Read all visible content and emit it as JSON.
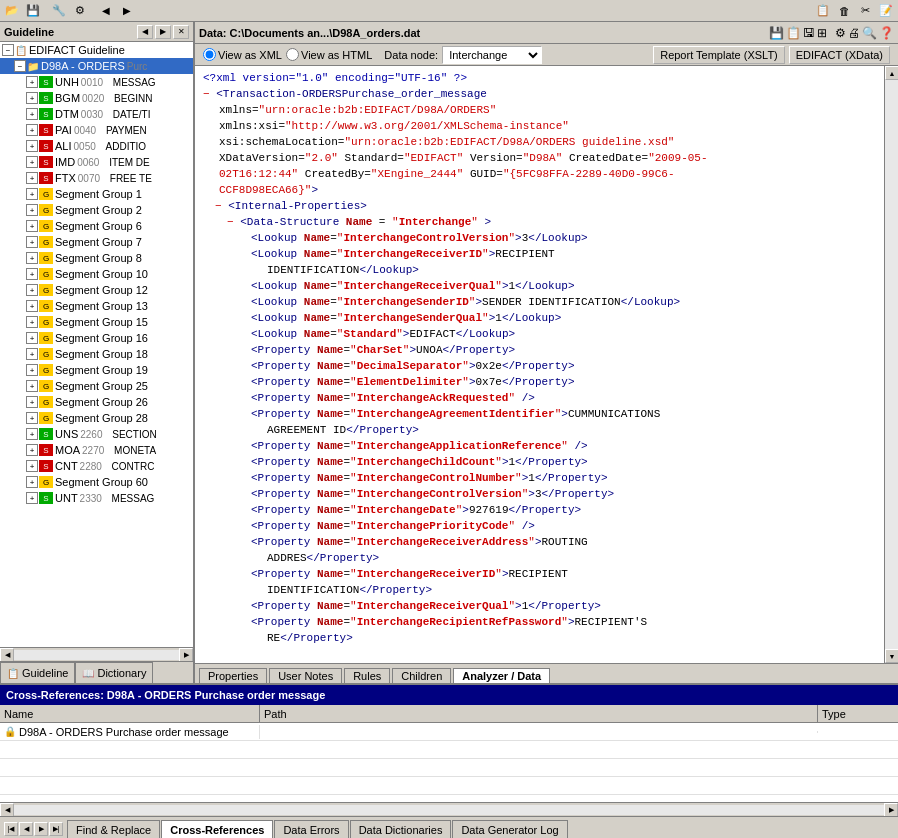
{
  "left_panel": {
    "title": "Guideline",
    "tree_items": [
      {
        "id": "edifact",
        "label": "EDIFACT Guideline",
        "indent": 0,
        "type": "root",
        "expanded": true
      },
      {
        "id": "d98a",
        "label": "D98A - ORDERS",
        "indent": 1,
        "type": "folder",
        "expanded": true,
        "suffix": "Purc"
      },
      {
        "id": "unh",
        "label": "UNH",
        "num": "0010",
        "desc": "MESSAG",
        "indent": 2,
        "type": "green",
        "expanded": false
      },
      {
        "id": "bgm",
        "label": "BGM",
        "num": "0020",
        "desc": "BEGINN",
        "indent": 2,
        "type": "green",
        "expanded": false
      },
      {
        "id": "dtm",
        "label": "DTM",
        "num": "0030",
        "desc": "DATE/TI",
        "indent": 2,
        "type": "green",
        "expanded": false
      },
      {
        "id": "pai",
        "label": "PAI",
        "num": "0040",
        "desc": "PAYMEN",
        "indent": 2,
        "type": "red",
        "expanded": false
      },
      {
        "id": "ali",
        "label": "ALI",
        "num": "0050",
        "desc": "ADDITIO",
        "indent": 2,
        "type": "red",
        "expanded": false
      },
      {
        "id": "imd",
        "label": "IMD",
        "num": "0060",
        "desc": "ITEM DE",
        "indent": 2,
        "type": "red",
        "expanded": false
      },
      {
        "id": "ftx",
        "label": "FTX",
        "num": "0070",
        "desc": "FREE TE",
        "indent": 2,
        "type": "red",
        "expanded": false
      },
      {
        "id": "sg1",
        "label": "Segment Group 1",
        "indent": 2,
        "type": "folder_grp",
        "expanded": false
      },
      {
        "id": "sg2",
        "label": "Segment Group 2",
        "indent": 2,
        "type": "folder_grp",
        "expanded": false
      },
      {
        "id": "sg6",
        "label": "Segment Group 6",
        "indent": 2,
        "type": "folder_grp",
        "expanded": false
      },
      {
        "id": "sg7",
        "label": "Segment Group 7",
        "indent": 2,
        "type": "folder_grp",
        "expanded": false
      },
      {
        "id": "sg8",
        "label": "Segment Group 8",
        "indent": 2,
        "type": "folder_grp",
        "expanded": false
      },
      {
        "id": "sg10",
        "label": "Segment Group 10",
        "indent": 2,
        "type": "folder_grp",
        "expanded": false
      },
      {
        "id": "sg12",
        "label": "Segment Group 12",
        "indent": 2,
        "type": "folder_grp",
        "expanded": false
      },
      {
        "id": "sg13",
        "label": "Segment Group 13",
        "indent": 2,
        "type": "folder_grp",
        "expanded": false
      },
      {
        "id": "sg15",
        "label": "Segment Group 15",
        "indent": 2,
        "type": "folder_grp",
        "expanded": false
      },
      {
        "id": "sg16",
        "label": "Segment Group 16",
        "indent": 2,
        "type": "folder_grp",
        "expanded": false
      },
      {
        "id": "sg18",
        "label": "Segment Group 18",
        "indent": 2,
        "type": "folder_grp",
        "expanded": false
      },
      {
        "id": "sg19",
        "label": "Segment Group 19",
        "indent": 2,
        "type": "folder_grp",
        "expanded": false
      },
      {
        "id": "sg25",
        "label": "Segment Group 25",
        "indent": 2,
        "type": "folder_grp",
        "expanded": false
      },
      {
        "id": "sg26",
        "label": "Segment Group 26",
        "indent": 2,
        "type": "folder_grp",
        "expanded": false
      },
      {
        "id": "sg28",
        "label": "Segment Group 28",
        "indent": 2,
        "type": "folder_grp",
        "expanded": false
      },
      {
        "id": "uns",
        "label": "UNS",
        "num": "2260",
        "desc": "SECTION",
        "indent": 2,
        "type": "green",
        "expanded": false
      },
      {
        "id": "moa",
        "label": "MOA",
        "num": "2270",
        "desc": "MONETA",
        "indent": 2,
        "type": "red",
        "expanded": false
      },
      {
        "id": "cnt",
        "label": "CNT",
        "num": "2280",
        "desc": "CONTRC",
        "indent": 2,
        "type": "red",
        "expanded": false
      },
      {
        "id": "sg60",
        "label": "Segment Group 60",
        "indent": 2,
        "type": "folder_grp",
        "expanded": false
      },
      {
        "id": "unt",
        "label": "UNT",
        "num": "2330",
        "desc": "MESSAG",
        "indent": 2,
        "type": "green",
        "expanded": false
      }
    ],
    "tabs": [
      {
        "id": "guideline",
        "label": "Guideline",
        "active": true,
        "icon": "G"
      },
      {
        "id": "dictionary",
        "label": "Dictionary",
        "active": false,
        "icon": "D"
      }
    ]
  },
  "right_panel": {
    "data_title": "Data: C:\\Documents an...\\D98A_orders.dat",
    "view_xml_label": "View as XML",
    "view_html_label": "View as HTML",
    "data_node_label": "Data node:",
    "data_node_value": "Interchange",
    "report_template_label": "Report Template (XSLT)",
    "edifact_xdata_label": "EDIFACT (XData)",
    "xml_lines": [
      {
        "type": "pi",
        "text": "<?xml version=\"1.0\" encoding=\"UTF-16\" ?>"
      },
      {
        "type": "minus_tag",
        "text": "<Transaction-ORDERSPurchase_order_message"
      },
      {
        "type": "attr_line",
        "text": "  xmlns=\"urn:oracle:b2b:EDIFACT/D98A/ORDERS\""
      },
      {
        "type": "attr_line",
        "text": "  xmlns:xsi=\"http://www.w3.org/2001/XMLSchema-instance\""
      },
      {
        "type": "attr_line",
        "text": "  xsi:schemaLocation=\"urn:oracle:b2b:EDIFACT/D98A/ORDERS guideline.xsd\""
      },
      {
        "type": "attr_line",
        "text": "  XDataVersion=\"2.0\" Standard=\"EDIFACT\" Version=\"D98A\" CreatedDate=\"2009-05-"
      },
      {
        "type": "attr_line",
        "text": "  02T16:12:44\" CreatedBy=\"XEngine_2444\" GUID=\"{5FC98FFA-2289-40D0-99C6-"
      },
      {
        "type": "attr_line",
        "text": "  CCF8D98ECA66}\">"
      },
      {
        "type": "minus_tag",
        "text": "  <Internal-Properties>"
      },
      {
        "type": "minus_tag",
        "text": "    <Data-Structure Name=\"Interchange\">"
      },
      {
        "type": "lookup",
        "text": "      <Lookup Name=\"InterchangeControlVersion\">3</Lookup>"
      },
      {
        "type": "lookup",
        "text": "      <Lookup Name=\"InterchangeReceiverID\">RECIPIENT"
      },
      {
        "type": "lookup",
        "text": "        IDENTIFICATION</Lookup>"
      },
      {
        "type": "lookup",
        "text": "      <Lookup Name=\"InterchangeReceiverQual\">1</Lookup>"
      },
      {
        "type": "lookup",
        "text": "      <Lookup Name=\"InterchangeSenderID\">SENDER IDENTIFICATION</Lookup>"
      },
      {
        "type": "lookup",
        "text": "      <Lookup Name=\"InterchangeSenderQual\">1</Lookup>"
      },
      {
        "type": "lookup",
        "text": "      <Lookup Name=\"Standard\">EDIFACT</Lookup>"
      },
      {
        "type": "property",
        "text": "      <Property Name=\"CharSet\">UNOA</Property>"
      },
      {
        "type": "property",
        "text": "      <Property Name=\"DecimalSeparator\">0x2e</Property>"
      },
      {
        "type": "property",
        "text": "      <Property Name=\"ElementDelimiter\">0x7e</Property>"
      },
      {
        "type": "property",
        "text": "      <Property Name=\"InterchangeAckRequested\" />"
      },
      {
        "type": "property",
        "text": "      <Property Name=\"InterchangeAgreementIdentifier\">CUMMUNICATIONS"
      },
      {
        "type": "property",
        "text": "        AGREEMENT ID</Property>"
      },
      {
        "type": "property",
        "text": "      <Property Name=\"InterchangeApplicationReference\" />"
      },
      {
        "type": "property",
        "text": "      <Property Name=\"InterchangeChildCount\">1</Property>"
      },
      {
        "type": "property",
        "text": "      <Property Name=\"InterchangeControlNumber\">1</Property>"
      },
      {
        "type": "property",
        "text": "      <Property Name=\"InterchangeControlVersion\">3</Property>"
      },
      {
        "type": "property",
        "text": "      <Property Name=\"InterchangeDate\">927619</Property>"
      },
      {
        "type": "property",
        "text": "      <Property Name=\"InterchangePriorityCode\" />"
      },
      {
        "type": "property",
        "text": "      <Property Name=\"InterchangeReceiverAddress\">ROUTING"
      },
      {
        "type": "property",
        "text": "        ADDRES</Property>"
      },
      {
        "type": "property",
        "text": "      <Property Name=\"InterchangeReceiverID\">RECIPIENT"
      },
      {
        "type": "property",
        "text": "        IDENTIFICATION</Property>"
      },
      {
        "type": "property",
        "text": "      <Property Name=\"InterchangeReceiverQual\">1</Property>"
      },
      {
        "type": "property",
        "text": "      <Property Name=\"InterchangeRecipientRefPassword\">RECIPIENT'S"
      },
      {
        "type": "property",
        "text": "        RE</Property>"
      }
    ],
    "bottom_tabs": [
      {
        "id": "properties",
        "label": "Properties",
        "active": false
      },
      {
        "id": "user_notes",
        "label": "User Notes",
        "active": false
      },
      {
        "id": "rules",
        "label": "Rules",
        "active": false
      },
      {
        "id": "children",
        "label": "Children",
        "active": false
      },
      {
        "id": "analyzer_data",
        "label": "Analyzer / Data",
        "active": true
      }
    ]
  },
  "cross_ref": {
    "title": "Cross-References: D98A - ORDERS Purchase order message",
    "columns": [
      "Name",
      "Path",
      "Type"
    ],
    "rows": [
      {
        "icon": "lock",
        "name": "D98A - ORDERS Purchase order message",
        "path": "",
        "type": ""
      }
    ]
  },
  "bottom_tabs": [
    {
      "id": "find_replace",
      "label": "Find & Replace",
      "active": false
    },
    {
      "id": "cross_references",
      "label": "Cross-References",
      "active": true
    },
    {
      "id": "data_errors",
      "label": "Data Errors",
      "active": false
    },
    {
      "id": "data_dictionaries",
      "label": "Data Dictionaries",
      "active": false
    },
    {
      "id": "data_generator_log",
      "label": "Data Generator Log",
      "active": false
    }
  ]
}
